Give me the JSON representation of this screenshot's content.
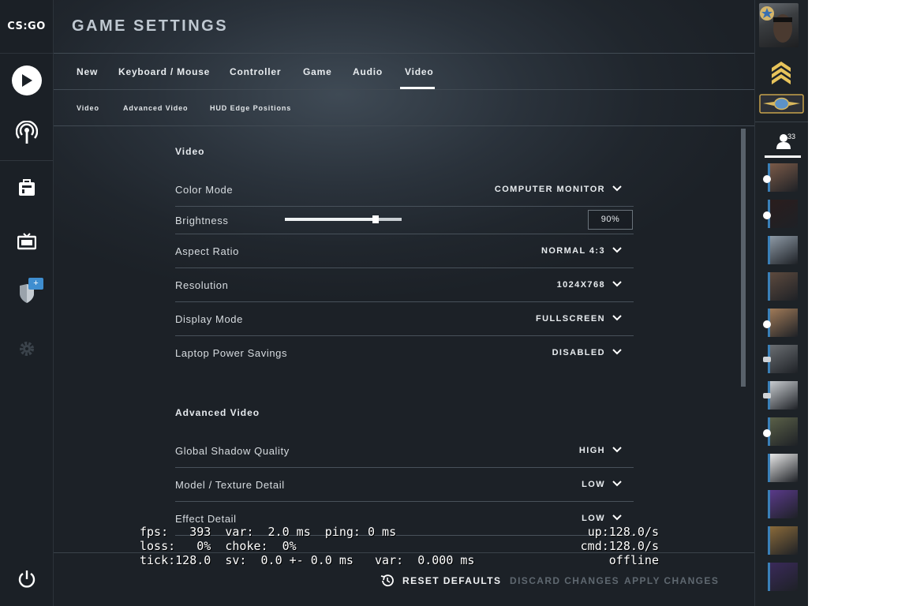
{
  "app": {
    "logo": "CS:GO",
    "title": "GAME SETTINGS"
  },
  "tabs": [
    "New",
    "Keyboard / Mouse",
    "Controller",
    "Game",
    "Audio",
    "Video"
  ],
  "active_tab": "Video",
  "subtabs": [
    "Video",
    "Advanced Video",
    "HUD Edge Positions"
  ],
  "video": {
    "title": "Video",
    "color_mode": {
      "label": "Color Mode",
      "value": "COMPUTER MONITOR"
    },
    "brightness": {
      "label": "Brightness",
      "value": "90%",
      "level": 0.78
    },
    "aspect_ratio": {
      "label": "Aspect Ratio",
      "value": "NORMAL 4:3"
    },
    "resolution": {
      "label": "Resolution",
      "value": "1024X768"
    },
    "display_mode": {
      "label": "Display Mode",
      "value": "FULLSCREEN"
    },
    "laptop_power": {
      "label": "Laptop Power Savings",
      "value": "DISABLED"
    }
  },
  "advanced": {
    "title": "Advanced Video",
    "shadow": {
      "label": "Global Shadow Quality",
      "value": "HIGH"
    },
    "texture": {
      "label": "Model / Texture Detail",
      "value": "LOW"
    },
    "effect": {
      "label": "Effect Detail",
      "value": "LOW"
    }
  },
  "netgraph": {
    "line1_left": "fps:   393  var:  2.0 ms  ping: 0 ms",
    "line1_right": "up:128.0/s",
    "line2_left": "loss:   0%  choke:  0%",
    "line2_right": "cmd:128.0/s",
    "line3_left": "tick:128.0  sv:  0.0 +- 0.0 ms   var:  0.000 ms",
    "line3_right": "offline"
  },
  "footer": {
    "reset": "RESET DEFAULTS",
    "discard": "DISCARD CHANGES",
    "apply": "APPLY CHANGES"
  },
  "friends": {
    "count": "33",
    "items": 12
  },
  "colors": {
    "accent": "#3f8ed0",
    "background": "#20262d",
    "text": "#d8dde2"
  },
  "icons": [
    "play-icon",
    "broadcast-icon",
    "inventory-icon",
    "tv-icon",
    "shield-icon",
    "gear-icon",
    "power-icon",
    "reset-icon",
    "chevron-down-icon",
    "friend-icon"
  ]
}
